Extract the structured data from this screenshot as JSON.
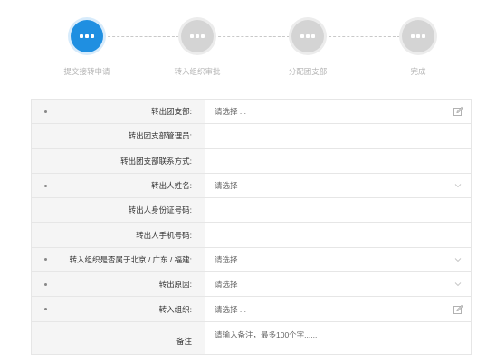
{
  "steps": [
    {
      "label": "提交接转申请",
      "state": "active"
    },
    {
      "label": "转入组织审批",
      "state": "inactive"
    },
    {
      "label": "分配团支部",
      "state": "inactive"
    },
    {
      "label": "完成",
      "state": "inactive"
    }
  ],
  "form": {
    "rows": [
      {
        "label": "转出团支部:",
        "required": true,
        "value": "请选择 ...",
        "icon": "edit-icon"
      },
      {
        "label": "转出团支部管理员:",
        "required": false,
        "value": "",
        "icon": ""
      },
      {
        "label": "转出团支部联系方式:",
        "required": false,
        "value": "",
        "icon": ""
      },
      {
        "label": "转出人姓名:",
        "required": true,
        "value": "请选择",
        "icon": "chevron-down-icon"
      },
      {
        "label": "转出人身份证号码:",
        "required": false,
        "value": "",
        "icon": ""
      },
      {
        "label": "转出人手机号码:",
        "required": false,
        "value": "",
        "icon": ""
      },
      {
        "label": "转入组织是否属于北京 / 广东 / 福建:",
        "required": true,
        "value": "请选择",
        "icon": "chevron-down-icon"
      },
      {
        "label": "转出原因:",
        "required": true,
        "value": "请选择",
        "icon": "chevron-down-icon"
      },
      {
        "label": "转入组织:",
        "required": true,
        "value": "请选择 ...",
        "icon": "edit-icon"
      },
      {
        "label": "备注",
        "required": false,
        "value": "请输入备注，最多100个字......",
        "icon": "",
        "tall": true
      }
    ]
  }
}
